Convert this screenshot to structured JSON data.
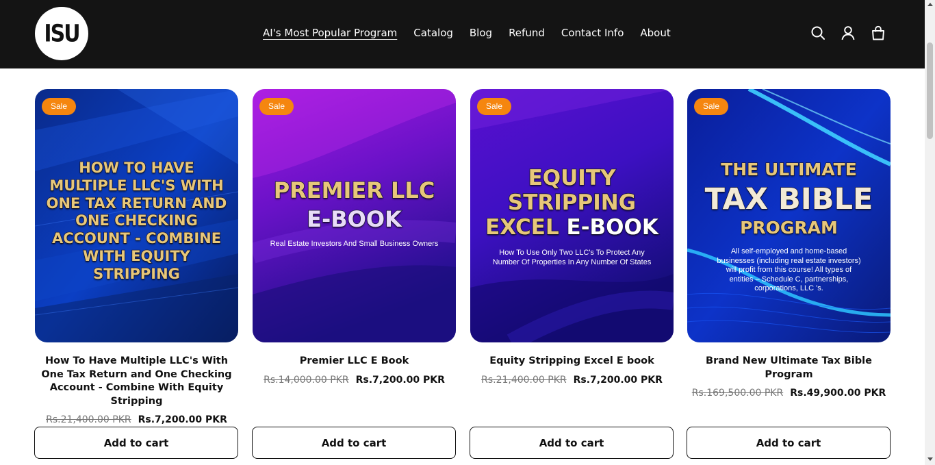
{
  "brand": {
    "logo_text": "ISU"
  },
  "nav": {
    "items": [
      {
        "label": "AI's Most Popular Program"
      },
      {
        "label": "Catalog"
      },
      {
        "label": "Blog"
      },
      {
        "label": "Refund"
      },
      {
        "label": "Contact Info"
      },
      {
        "label": "About"
      }
    ]
  },
  "header_icons": [
    "search-icon",
    "account-icon",
    "cart-icon"
  ],
  "products": [
    {
      "badge": "Sale",
      "cover": {
        "headline": [
          "HOW TO HAVE",
          "MULTIPLE LLC'S WITH",
          "ONE TAX RETURN AND",
          "ONE CHECKING",
          "ACCOUNT - COMBINE",
          "WITH EQUITY",
          "STRIPPING"
        ]
      },
      "title": "How To Have Multiple LLC's With One Tax Return and One Checking Account - Combine With Equity Stripping",
      "old_price": "Rs.21,400.00 PKR",
      "new_price": "Rs.7,200.00 PKR",
      "button": "Add to cart"
    },
    {
      "badge": "Sale",
      "cover": {
        "line1": "PREMIER LLC",
        "line2": "E-BOOK",
        "subtitle": "Real Estate Investors And Small Business Owners"
      },
      "title": "Premier LLC E Book",
      "old_price": "Rs.14,000.00 PKR",
      "new_price": "Rs.7,200.00 PKR",
      "button": "Add to cart"
    },
    {
      "badge": "Sale",
      "cover": {
        "line1": "EQUITY",
        "line2": "STRIPPING",
        "line3a": "EXCEL ",
        "line3b": "E-BOOK",
        "subtitle1": "How To Use Only Two LLC's To Protect Any",
        "subtitle2": "Number Of Properties In Any Number Of States"
      },
      "title": "Equity Stripping Excel E book",
      "old_price": "Rs.21,400.00 PKR",
      "new_price": "Rs.7,200.00 PKR",
      "button": "Add to cart"
    },
    {
      "badge": "Sale",
      "cover": {
        "line1": "THE ULTIMATE",
        "line2": "TAX BIBLE",
        "line3": "PROGRAM",
        "body": [
          "All self-employed and home-based",
          "businesses (including real estate investors)",
          "will profit from this course! All types of",
          "entities – Schedule C, partnerships,",
          "corporations, LLC 's."
        ]
      },
      "title": "Brand New Ultimate Tax Bible Program",
      "old_price": "Rs.169,500.00 PKR",
      "new_price": "Rs.49,900.00 PKR",
      "button": "Add to cart"
    }
  ],
  "colors": {
    "header_bg": "#141414",
    "sale_badge": "#f5860f",
    "cover_gold": "#e7c77a"
  }
}
